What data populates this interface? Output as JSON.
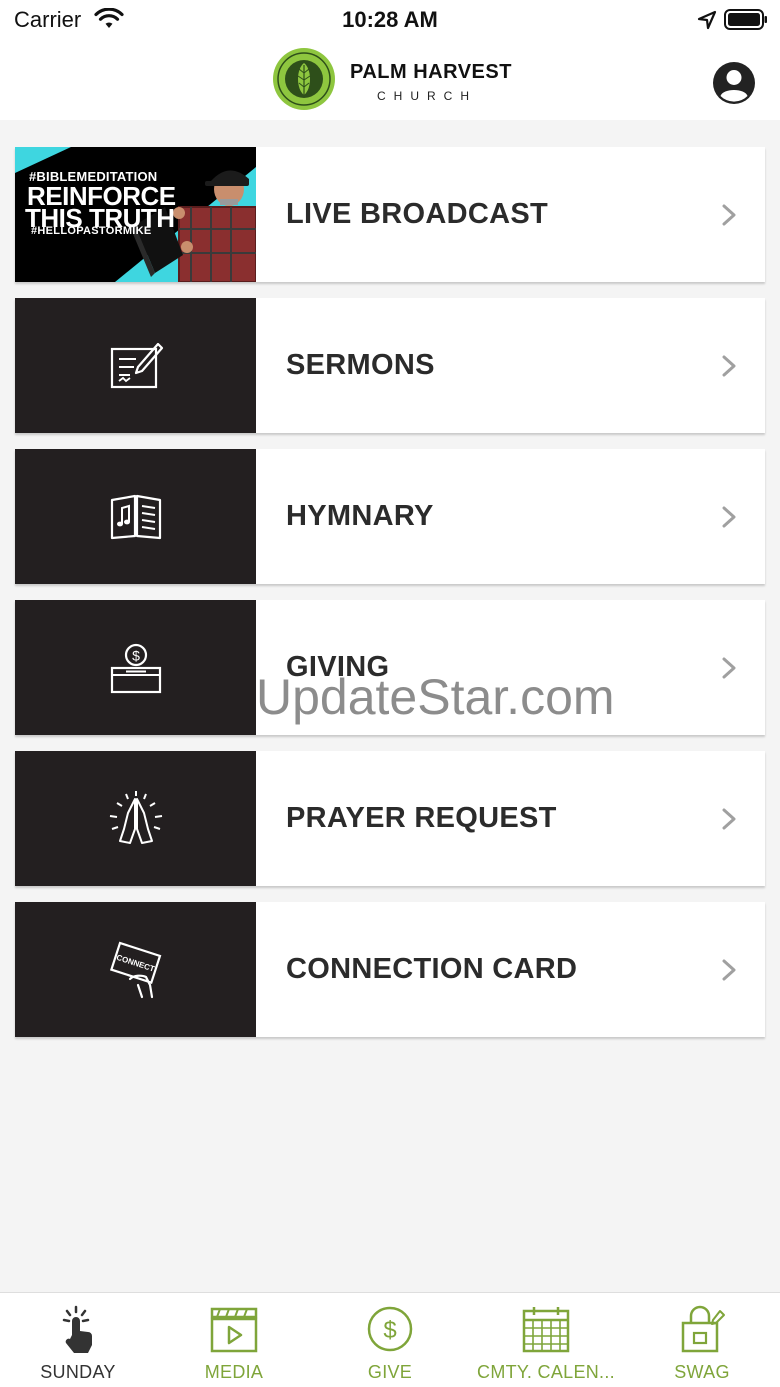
{
  "status_bar": {
    "carrier": "Carrier",
    "time": "10:28 AM"
  },
  "header": {
    "logo_title": "PALM HARVEST",
    "logo_subtitle": "CHURCH",
    "logo_seal_text": "PALM HARVEST · COSTA MESA, CA",
    "icons": {
      "profile": "profile-icon"
    }
  },
  "menu": {
    "items": [
      {
        "label": "LIVE BROADCAST",
        "thumbnail": {
          "hashtag": "#BIBLEMEDITATION",
          "title_line1": "REINFORCE",
          "title_line2": "THIS TRUTH",
          "tag": "#HELLOPASTORMIKE"
        }
      },
      {
        "label": "SERMONS",
        "icon": "sermon-notes-icon"
      },
      {
        "label": "HYMNARY",
        "icon": "hymn-book-icon"
      },
      {
        "label": "GIVING",
        "icon": "donation-box-icon"
      },
      {
        "label": "PRAYER REQUEST",
        "icon": "praying-hands-icon"
      },
      {
        "label": "CONNECTION CARD",
        "icon": "connect-card-icon"
      }
    ]
  },
  "watermark": "UpdateStar.com",
  "tab_bar": {
    "tabs": [
      {
        "label": "SUNDAY",
        "icon": "tap-hand-icon",
        "active": true
      },
      {
        "label": "MEDIA",
        "icon": "media-player-icon",
        "active": false
      },
      {
        "label": "GIVE",
        "icon": "dollar-coin-icon",
        "active": false
      },
      {
        "label": "CMTY. CALEN...",
        "icon": "calendar-icon",
        "active": false
      },
      {
        "label": "SWAG",
        "icon": "shopping-bag-icon",
        "active": false
      }
    ]
  },
  "colors": {
    "accent_green": "#7fa53a",
    "tile_dark": "#231f20",
    "thumb_cyan": "#3ed6e0",
    "active_tab": "#333333",
    "background": "#f4f4f4"
  }
}
